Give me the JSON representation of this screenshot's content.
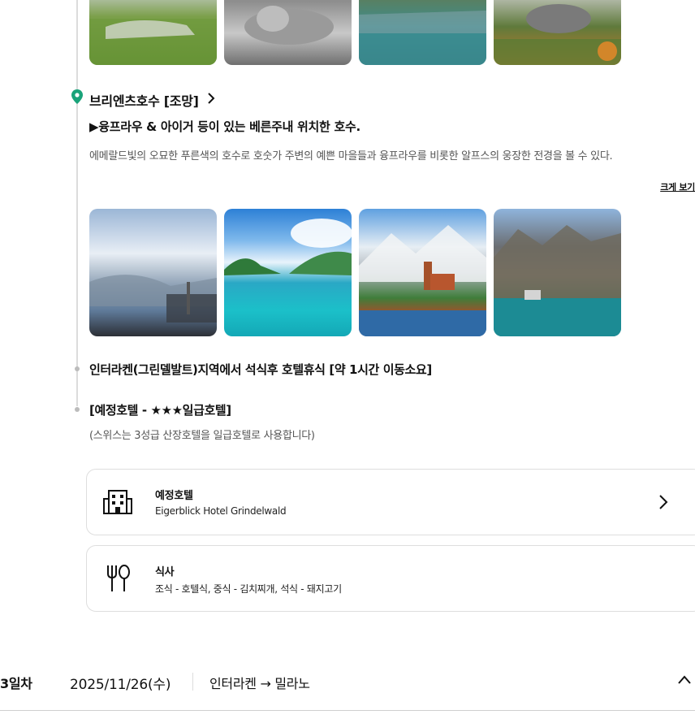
{
  "poi": {
    "title": "브리엔츠호수 [조망]",
    "highlight": "▶융프라우 & 아이거 등이 있는 베른주내 위치한 호수.",
    "description": "에메랄드빛의 오묘한 푸른색의 호수로 호숫가 주변의 예쁜 마을들과 융프라우를 비롯한 알프스의 웅장한 전경을 볼 수 있다.",
    "big_view_label": "크게 보기"
  },
  "steps": {
    "move": "인터라켄(그린델발트)지역에서 석식후 호텔휴식 [약 1시간 이동소요]",
    "hotel_label": "[예정호텔 - ★★★일급호텔]",
    "hotel_note": "(스위스는 3성급 산장호텔을 일급호텔로 사용합니다)"
  },
  "cards": {
    "hotel": {
      "title": "예정호텔",
      "value": "Eigerblick Hotel Grindelwald",
      "icon": "building-icon"
    },
    "meal": {
      "title": "식사",
      "value": "조식 - 호텔식, 중식 - 김치찌개, 석식 - 돼지고기",
      "icon": "fork-spoon-icon"
    }
  },
  "next_day": {
    "label": "3일차",
    "date": "2025/11/26(수)",
    "route": "인터라켄 → 밀라노"
  },
  "colors": {
    "accent": "#1aa37a",
    "border": "#dedede",
    "muted": "#555555"
  }
}
